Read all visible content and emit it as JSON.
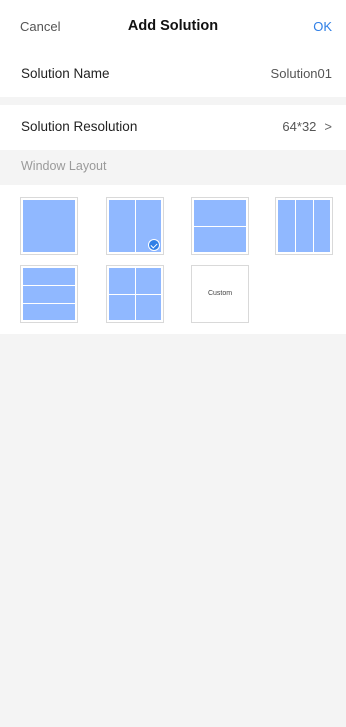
{
  "nav": {
    "cancel_label": "Cancel",
    "title": "Add Solution",
    "ok_label": "OK"
  },
  "solution_name": {
    "label": "Solution Name",
    "value": "Solution01"
  },
  "solution_resolution": {
    "label": "Solution Resolution",
    "value": "64*32",
    "chevron": ">"
  },
  "window_layout": {
    "title": "Window Layout",
    "options": [
      {
        "id": "single",
        "selected": false
      },
      {
        "id": "two-vertical",
        "selected": true
      },
      {
        "id": "two-horizontal",
        "selected": false
      },
      {
        "id": "three-vertical",
        "selected": false
      },
      {
        "id": "three-horizontal",
        "selected": false
      },
      {
        "id": "four-grid",
        "selected": false
      },
      {
        "id": "custom",
        "label": "Custom",
        "selected": false
      }
    ]
  },
  "colors": {
    "accent": "#2f7fe6",
    "tile_fill": "#90b8ff",
    "background": "#f4f4f4"
  }
}
